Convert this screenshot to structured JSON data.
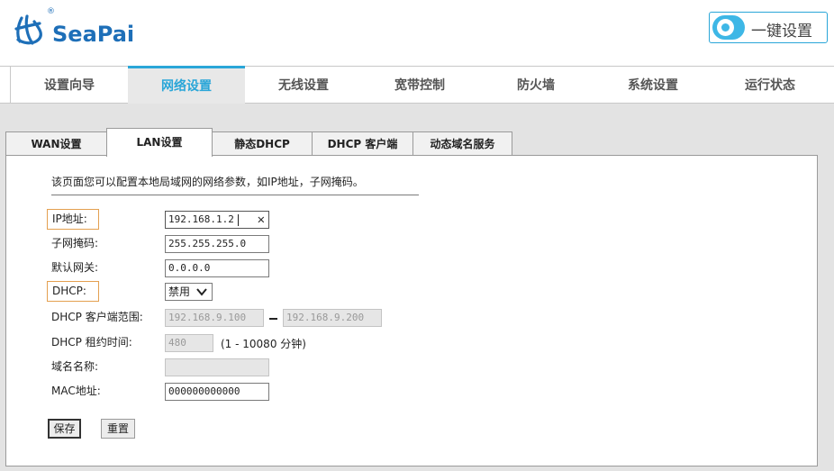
{
  "header": {
    "brand": "SeaPai",
    "brand_reg": "®",
    "quick_setup_label": "一键设置"
  },
  "main_nav": {
    "items": [
      {
        "label": "设置向导"
      },
      {
        "label": "网络设置"
      },
      {
        "label": "无线设置"
      },
      {
        "label": "宽带控制"
      },
      {
        "label": "防火墙"
      },
      {
        "label": "系统设置"
      },
      {
        "label": "运行状态"
      }
    ],
    "active": "网络设置"
  },
  "sub_tabs": {
    "items": [
      {
        "label": "WAN设置"
      },
      {
        "label": "LAN设置"
      },
      {
        "label": "静态DHCP"
      },
      {
        "label": "DHCP 客户端"
      },
      {
        "label": "动态域名服务"
      }
    ],
    "active": "LAN设置"
  },
  "lan": {
    "description": "该页面您可以配置本地局域网的网络参数，如IP地址，子网掩码。",
    "ip_label": "IP地址:",
    "ip_value": "192.168.1.2",
    "clear_glyph": "✕",
    "mask_label": "子网掩码:",
    "mask_value": "255.255.255.0",
    "gateway_label": "默认网关:",
    "gateway_value": "0.0.0.0",
    "dhcp_label": "DHCP:",
    "dhcp_value": "禁用",
    "range_label": "DHCP 客户端范围:",
    "range_start": "192.168.9.100",
    "range_end": "192.168.9.200",
    "lease_label": "DHCP 租约时间:",
    "lease_value": "480",
    "lease_hint": "(1 - 10080 分钟)",
    "domain_label": "域名名称:",
    "domain_value": "",
    "mac_label": "MAC地址:",
    "mac_value": "000000000000",
    "save_label": "保存",
    "reset_label": "重置"
  },
  "colors": {
    "accent": "#2aa6d8",
    "brand": "#1e6fb8",
    "highlight_border": "#e4a050",
    "band": "#e3e3e3"
  },
  "icons": [
    "seapai-logo-icon",
    "toggle-icon",
    "clear-icon",
    "chevron-down-icon"
  ]
}
